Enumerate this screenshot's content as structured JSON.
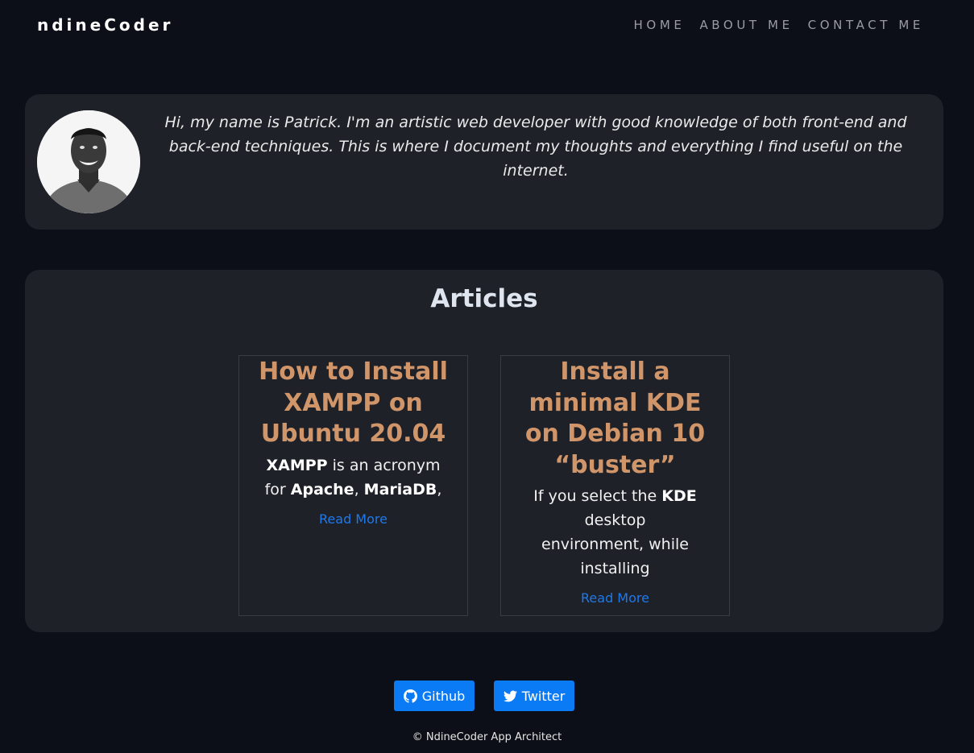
{
  "header": {
    "brand": "ndineCoder",
    "nav": [
      "HOME",
      "ABOUT ME",
      "CONTACT ME"
    ]
  },
  "intro": {
    "text": "Hi, my name is Patrick. I'm an artistic web developer with good knowledge of both front-end and back-end techniques. This is where I document my thoughts and everything I find useful on the internet."
  },
  "articles": {
    "heading": "Articles",
    "items": [
      {
        "title": "How to Install XAMPP on Ubuntu 20.04",
        "excerpt": [
          {
            "text": "XAMPP",
            "bold": true
          },
          {
            "text": " is an acronym for ",
            "bold": false
          },
          {
            "text": "Apache",
            "bold": true
          },
          {
            "text": ", ",
            "bold": false
          },
          {
            "text": "MariaDB",
            "bold": true
          },
          {
            "text": ",",
            "bold": false
          }
        ],
        "read_more": "Read More"
      },
      {
        "title": "Install a minimal KDE on Debian 10 “buster”",
        "excerpt": [
          {
            "text": "If you select the ",
            "bold": false
          },
          {
            "text": "KDE",
            "bold": true
          },
          {
            "text": " desktop environment, while installing",
            "bold": false
          }
        ],
        "read_more": "Read More"
      }
    ]
  },
  "social": {
    "github_label": "Github",
    "twitter_label": "Twitter"
  },
  "footer": {
    "text": "© NdineCoder App Architect"
  },
  "colors": {
    "background": "#0c0f17",
    "panel": "#1f2129",
    "article_title": "#d1956a",
    "link": "#1f79e8",
    "button": "#0a7bf5"
  },
  "icons": [
    "github-icon",
    "twitter-icon",
    "avatar-photo"
  ]
}
